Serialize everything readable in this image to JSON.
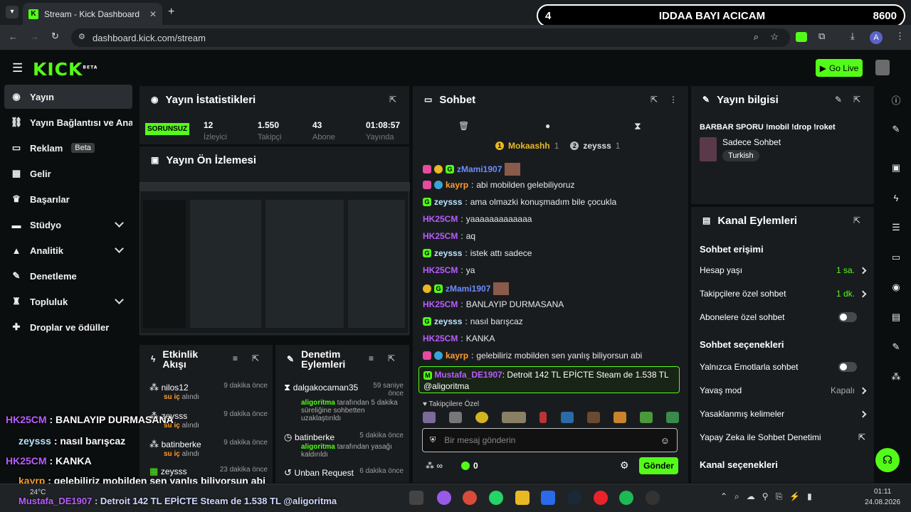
{
  "browser": {
    "tab_title": "Stream - Kick Dashboard",
    "url": "dashboard.kick.com/stream",
    "profile_initial": "A"
  },
  "overlay": {
    "left": "4",
    "title": "IDDAA BAYI ACICAM",
    "right": "8600"
  },
  "header": {
    "logo": "KICK",
    "beta": "BETA",
    "go_live": "Go Live"
  },
  "nav": [
    {
      "label": "Yayın"
    },
    {
      "label": "Yayın Bağlantısı ve Anahtar"
    },
    {
      "label": "Reklam",
      "badge": "Beta"
    },
    {
      "label": "Gelir"
    },
    {
      "label": "Başarılar"
    },
    {
      "label": "Stüdyo"
    },
    {
      "label": "Analitik"
    },
    {
      "label": "Denetleme"
    },
    {
      "label": "Topluluk"
    },
    {
      "label": "Droplar ve ödüller"
    }
  ],
  "stats": {
    "title": "Yayın İstatistikleri",
    "status": "SORUNSUZ",
    "items": [
      {
        "value": "12",
        "label": "İzleyici"
      },
      {
        "value": "1.550",
        "label": "Takipçi"
      },
      {
        "value": "43",
        "label": "Abone"
      },
      {
        "value": "01:08:57",
        "label": "Yayında"
      }
    ]
  },
  "preview": {
    "title": "Yayın Ön İzlemesi"
  },
  "activity": {
    "title": "Etkinlik Akışı",
    "items": [
      {
        "name": "nilos12",
        "action": "su iç",
        "suffix": " alındı",
        "time": "9 dakika önce"
      },
      {
        "name": "zeysss",
        "action": "su iç",
        "suffix": " alındı",
        "time": "9 dakika önce"
      },
      {
        "name": "batinberke",
        "action": "su iç",
        "suffix": " alındı",
        "time": "9 dakika önce"
      },
      {
        "name": "zeysss",
        "action": "",
        "suffix": "",
        "time": "23 dakika önce"
      }
    ]
  },
  "moderation": {
    "title": "Denetim Eylemleri",
    "items": [
      {
        "name": "dalgakocaman35",
        "time": "59 saniye önce",
        "actor": "aligoritma",
        "text": " tarafından 5 dakika süreliğine sohbetten uzaklaştırıldı"
      },
      {
        "name": "batinberke",
        "time": "5 dakika önce",
        "actor": "aligoritma",
        "text": " tarafından yasağı kaldırıldı"
      },
      {
        "name": "Unban Request",
        "time": "6 dakika önce",
        "actor": "",
        "text": ""
      }
    ]
  },
  "chat": {
    "title": "Sohbet",
    "top1": "Mokaashh",
    "top1_count": "1",
    "top2": "zeysss",
    "top2_count": "1",
    "messages": [
      {
        "user": "zMami1907",
        "text": "",
        "color": "blue"
      },
      {
        "user": "kayrp",
        "text": "abi mobilden gelebiliyoruz",
        "color": "orange"
      },
      {
        "user": "zeysss",
        "text": "ama olmazki konuşmadım bile çocukla",
        "color": "cyan"
      },
      {
        "user": "HK25CM",
        "text": "yaaaaaaaaaaaaa",
        "color": "purple"
      },
      {
        "user": "HK25CM",
        "text": "aq",
        "color": "purple"
      },
      {
        "user": "zeysss",
        "text": "istek attı sadece",
        "color": "cyan"
      },
      {
        "user": "HK25CM",
        "text": "ya",
        "color": "purple"
      },
      {
        "user": "zMami1907",
        "text": "",
        "color": "blue"
      },
      {
        "user": "HK25CM",
        "text": "BANLAYIP DURMASANA",
        "color": "purple"
      },
      {
        "user": "zeysss",
        "text": "nasıl barışcaz",
        "color": "cyan"
      },
      {
        "user": "HK25CM",
        "text": "KANKA",
        "color": "purple"
      },
      {
        "user": "kayrp",
        "text": "gelebiliriz mobilden sen yanlış biliyorsun abi",
        "color": "orange"
      }
    ],
    "highlight": {
      "user": "Mustafa_DE1907",
      "text": "Detroit 142 TL EPİCTE Steam de 1.538 TL",
      "mention": "@aligoritma"
    },
    "followers_only": "Takipçilere Özel",
    "placeholder": "Bir mesaj gönderin",
    "points": "0",
    "send": "Gönder"
  },
  "info": {
    "title": "Yayın bilgisi",
    "stream_title": "BARBAR SPORU !mobil !drop !roket",
    "category": "Sadece Sohbet",
    "language": "Turkish"
  },
  "channel": {
    "title": "Kanal Eylemleri",
    "access_title": "Sohbet erişimi",
    "access": [
      {
        "label": "Hesap yaşı",
        "value": "1 sa."
      },
      {
        "label": "Takipçilere özel sohbet",
        "value": "1 dk."
      },
      {
        "label": "Abonelere özel sohbet",
        "value": ""
      }
    ],
    "options_title": "Sohbet seçenekleri",
    "options": [
      {
        "label": "Yalnızca Emotlarla sohbet",
        "value": ""
      },
      {
        "label": "Yavaş mod",
        "value": "Kapalı"
      },
      {
        "label": "Yasaklanmış kelimeler",
        "value": ""
      },
      {
        "label": "Yapay Zeka ile Sohbet Denetimi",
        "value": ""
      }
    ],
    "channel_title": "Kanal seçenekleri"
  },
  "overlay_chat": [
    {
      "user": "HK25CM",
      "text": " : BANLAYIP DURMASANA"
    },
    {
      "user": "zeysss",
      "text": " : nasıl barışcaz"
    },
    {
      "user": "HK25CM",
      "text": " : KANKA"
    },
    {
      "user": "kayrp",
      "text": " : gelebiliriz mobilden sen yanlış biliyorsun abi"
    },
    {
      "user": "Mustafa_DE1907",
      "text": " : Detroit 142 TL EPİCTE Steam de 1.538 TL @aligoritma"
    }
  ],
  "taskbar": {
    "temp": "24°C",
    "time": "01:11",
    "date": "24.08.2026"
  }
}
